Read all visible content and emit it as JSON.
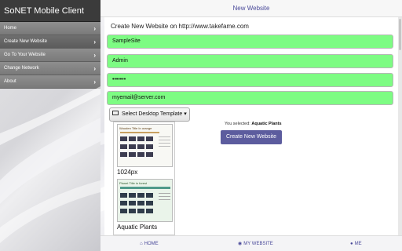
{
  "app": {
    "title": "SoNET Mobile Client"
  },
  "sidebar": {
    "items": [
      {
        "label": "Home",
        "chevron": "›"
      },
      {
        "label": "Create New Website",
        "chevron": "›"
      },
      {
        "label": "Go To Your Website",
        "chevron": "›"
      },
      {
        "label": "Change Network",
        "chevron": "›"
      },
      {
        "label": "About",
        "chevron": "›"
      }
    ]
  },
  "header": {
    "title": "New Website"
  },
  "form": {
    "heading": "Create New Website on http://www.takefame.com",
    "site_name": "SampleSite",
    "username": "Admin",
    "password": "•••••••",
    "email": "myemail@server.com",
    "template_button_label": "Select Desktop Template",
    "template_caret": "▾"
  },
  "templates": [
    {
      "name": "1024px",
      "image_title": "Wooden Title In orange"
    },
    {
      "name": "Aquatic Plants",
      "image_title": "Planet Title in forest"
    }
  ],
  "selection": {
    "prefix": "You selected:",
    "template": "Aquatic Plants"
  },
  "create_button_label": "Create New Website",
  "footer": {
    "home": "HOME",
    "my_website": "MY WEBSITE",
    "me": "ME"
  },
  "colors": {
    "field_green": "#7dfc83",
    "accent": "#5c5c9e",
    "sidebar_header": "#3b3b3b"
  },
  "icons": {
    "home": "home-icon",
    "globe": "globe-icon",
    "user": "user-icon",
    "monitor": "monitor-icon"
  }
}
